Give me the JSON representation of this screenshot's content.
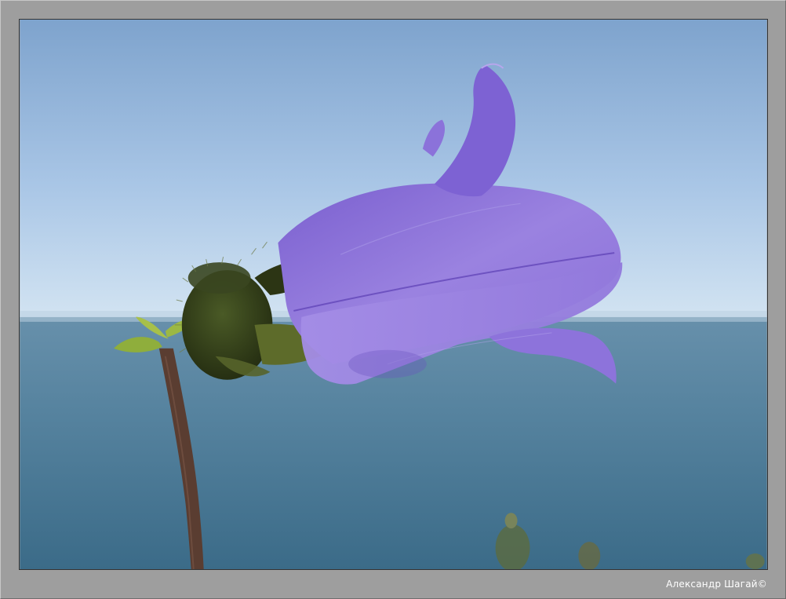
{
  "credit": "Александр Шагай©",
  "colors": {
    "frame": "#9e9e9e",
    "sky_top": "#7fa6cf",
    "sky_bottom": "#cfe2f2",
    "sea_top": "#5c89a3",
    "sea_bottom": "#3d6f8c",
    "petal": "#8f74d9",
    "petal_dark": "#6f55c4",
    "sepal": "#3b4a1e",
    "stem": "#5b3f33"
  }
}
